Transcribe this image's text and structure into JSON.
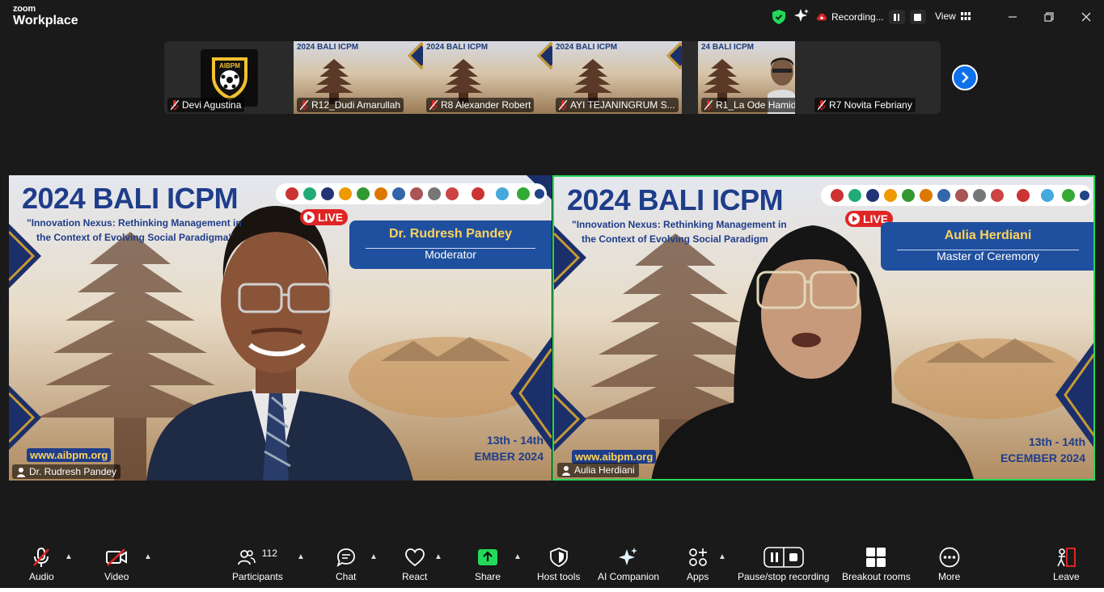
{
  "app": {
    "brand_top": "zoom",
    "brand_bottom": "Workplace"
  },
  "titlebar": {
    "recording_label": "Recording...",
    "view_label": "View"
  },
  "thumbnails": [
    {
      "name": "Devi Agustina",
      "kind": "logo",
      "logo_text": "AIBPM",
      "muted": true
    },
    {
      "name": "R12_Dudi Amarullah",
      "kind": "banner",
      "banner_title": "2024 BALI ICPM",
      "muted": true
    },
    {
      "name": "R8 Alexander Robert",
      "kind": "banner",
      "banner_title": "2024 BALI ICPM",
      "muted": true
    },
    {
      "name": "AYI TEJANINGRUM S...",
      "kind": "banner",
      "banner_title": "2024 BALI ICPM",
      "muted": true
    },
    {
      "name": "R1_La Ode Hamida",
      "kind": "banner",
      "banner_title": "24 BALI ICPM",
      "muted": true
    },
    {
      "name": "R7 Novita Febriany",
      "kind": "blank",
      "muted": true
    }
  ],
  "tiles": [
    {
      "participant": "Dr. Rudresh Pandey",
      "banner_title": "2024 BALI ICPM",
      "theme_line1": "\"Innovation Nexus: Rethinking Management in",
      "theme_line2": "the Context of Evolving Social Paradigma\"",
      "live_label": "LIVE",
      "card_name": "Dr. Rudresh Pandey",
      "card_role": "Moderator",
      "website": "www.aibpm.org",
      "date_line1": "13th - 14th",
      "date_line2": "EMBER 2024",
      "active_speaker": false
    },
    {
      "participant": "Aulia Herdiani",
      "banner_title": "2024 BALI ICPM",
      "theme_line1": "\"Innovation Nexus: Rethinking Management in",
      "theme_line2": "the Context of Evolving Social Paradigm",
      "live_label": "LIVE",
      "card_name": "Aulia Herdiani",
      "card_role": "Master of Ceremony",
      "website": "www.aibpm.org",
      "date_line1": "13th - 14th",
      "date_line2": "ECEMBER 2024",
      "active_speaker": true
    }
  ],
  "toolbar": {
    "audio": "Audio",
    "video": "Video",
    "participants": "Participants",
    "participants_count": "112",
    "chat": "Chat",
    "react": "React",
    "share": "Share",
    "host_tools": "Host tools",
    "ai_companion": "AI Companion",
    "apps": "Apps",
    "pause_stop": "Pause/stop recording",
    "breakout": "Breakout rooms",
    "more": "More",
    "leave": "Leave"
  },
  "colors": {
    "background": "#1a1a1a",
    "active_speaker_border": "#23d959",
    "share_green": "#23d959",
    "accent_blue": "#0e71eb",
    "live_red": "#e02424",
    "muted_red": "#e02424"
  }
}
